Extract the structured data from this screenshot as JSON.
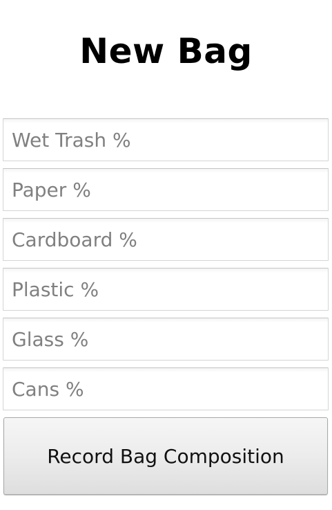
{
  "screen": {
    "title": "New Bag"
  },
  "fields": [
    {
      "placeholder": "Wet Trash %",
      "value": ""
    },
    {
      "placeholder": "Paper %",
      "value": ""
    },
    {
      "placeholder": "Cardboard %",
      "value": ""
    },
    {
      "placeholder": "Plastic %",
      "value": ""
    },
    {
      "placeholder": "Glass %",
      "value": ""
    },
    {
      "placeholder": "Cans %",
      "value": ""
    }
  ],
  "actions": {
    "record_label": "Record Bag Composition"
  }
}
